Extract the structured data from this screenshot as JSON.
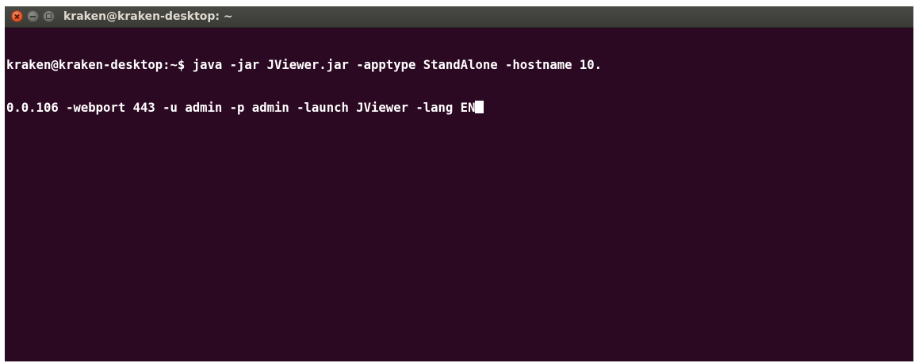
{
  "window": {
    "title": "kraken@kraken-desktop: ~"
  },
  "titlebar_buttons": {
    "close": "close-icon",
    "minimize": "minimize-icon",
    "maximize": "maximize-icon"
  },
  "terminal": {
    "lines": [
      "kraken@kraken-desktop:~$ java -jar JViewer.jar -apptype StandAlone -hostname 10.",
      "0.0.106 -webport 443 -u admin -p admin -launch JViewer -lang EN"
    ],
    "colors": {
      "background": "#2c0922",
      "foreground": "#ffffff"
    }
  }
}
